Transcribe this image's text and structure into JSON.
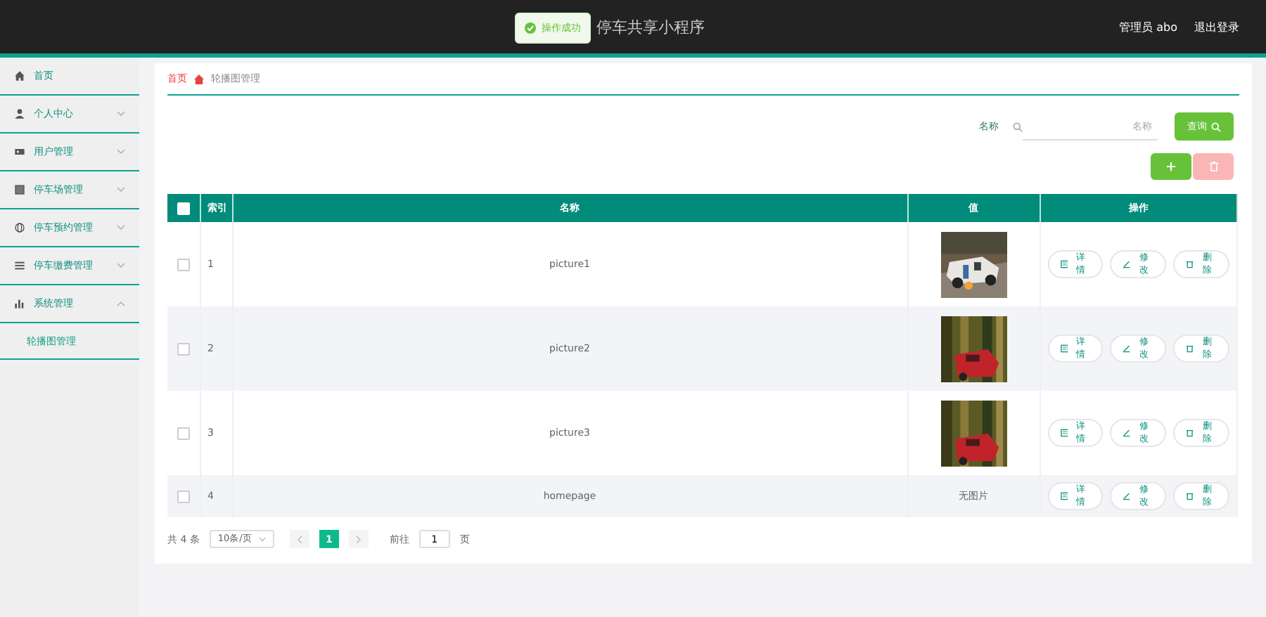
{
  "header": {
    "title": "停车共享小程序",
    "user": "管理员 abo",
    "logout": "退出登录"
  },
  "toast": {
    "message": "操作成功"
  },
  "sidebar": {
    "items": [
      {
        "label": "首页"
      },
      {
        "label": "个人中心",
        "expanded": false
      },
      {
        "label": "用户管理",
        "expanded": false
      },
      {
        "label": "停车场管理",
        "expanded": false
      },
      {
        "label": "停车预约管理",
        "expanded": false
      },
      {
        "label": "停车缴费管理",
        "expanded": false
      },
      {
        "label": "系统管理",
        "expanded": true,
        "children": [
          {
            "label": "轮播图管理",
            "selected": true
          }
        ]
      }
    ]
  },
  "breadcrumb": [
    "首页",
    "轮播图管理"
  ],
  "search": {
    "label": "名称",
    "placeholder": "名称",
    "button": "查询"
  },
  "table": {
    "all_checked": false,
    "columns": [
      "索引",
      "名称",
      "值",
      "操作"
    ],
    "rows": [
      {
        "checked": false,
        "index": "1",
        "name": "picture1",
        "value": {
          "kind": "picture"
        },
        "actions": [
          "详情",
          "修改",
          "删除"
        ]
      },
      {
        "checked": false,
        "index": "2",
        "name": "picture2",
        "value": {
          "kind": "picture"
        },
        "actions": [
          "详情",
          "修改",
          "删除"
        ]
      },
      {
        "checked": false,
        "index": "3",
        "name": "picture3",
        "value": {
          "kind": "picture"
        },
        "actions": [
          "详情",
          "修改",
          "删除"
        ]
      },
      {
        "checked": false,
        "index": "4",
        "name": "homepage",
        "value": {
          "kind": "text",
          "text": "无图片"
        },
        "actions": [
          "详情",
          "修改",
          "删除"
        ]
      }
    ]
  },
  "pagination": {
    "total": "共 4 条",
    "page_size": "10条/页",
    "pages": [
      {
        "label": "1",
        "selected": true
      }
    ],
    "goto_label": "前往",
    "goto_value": "1",
    "goto_suffix": "页"
  }
}
